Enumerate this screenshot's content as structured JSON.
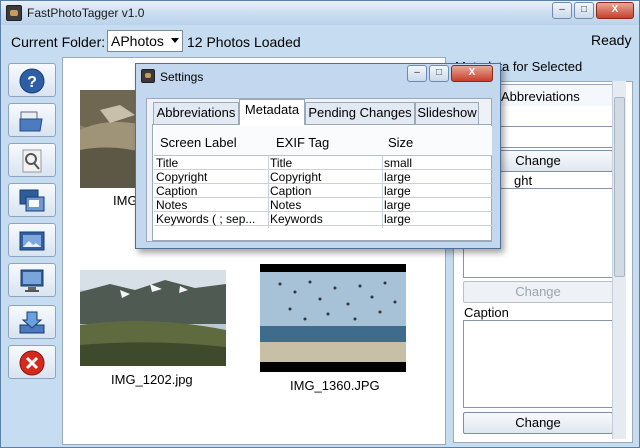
{
  "window": {
    "title": "FastPhotoTagger v1.0",
    "minimize": "–",
    "maximize": "□",
    "close": "X"
  },
  "toolbar": {
    "folder_label": "Current Folder:",
    "folder_value": "APhotos",
    "loaded_text": "12 Photos Loaded",
    "status_text": "Ready"
  },
  "tools": [
    "help-icon",
    "open-folder-icon",
    "search-icon",
    "slideshow-icon",
    "image-icon",
    "monitor-icon",
    "export-icon",
    "exit-icon"
  ],
  "photos": [
    {
      "filename": "IMG_",
      "scene": "rocky-hillside"
    },
    {
      "filename": "IMG_1202.jpg",
      "scene": "mountain-lake"
    },
    {
      "filename": "IMG_1360.JPG",
      "scene": "beach-birds"
    }
  ],
  "right_panel": {
    "title": "Metadata for Selected",
    "tab_label": "Abbreviations",
    "change_label": "Change",
    "copyright_partial": "ght",
    "caption_label": "Caption"
  },
  "settings": {
    "title": "Settings",
    "tabs": [
      "Abbreviations",
      "Metadata",
      "Pending Changes",
      "Slideshow"
    ],
    "active_tab": "Metadata",
    "columns": [
      "Screen Label",
      "EXIF Tag",
      "Size"
    ],
    "rows": [
      [
        "Title",
        "Title",
        "small"
      ],
      [
        "Copyright",
        "Copyright",
        "large"
      ],
      [
        "Caption",
        "Caption",
        "large"
      ],
      [
        "Notes",
        "Notes",
        "large"
      ],
      [
        "Keywords ( ; sep...",
        "Keywords",
        "large"
      ]
    ]
  },
  "colors": {
    "window_bg": "#c6dcf0",
    "accent": "#4f6f96",
    "exit_red": "#d42a1e"
  }
}
